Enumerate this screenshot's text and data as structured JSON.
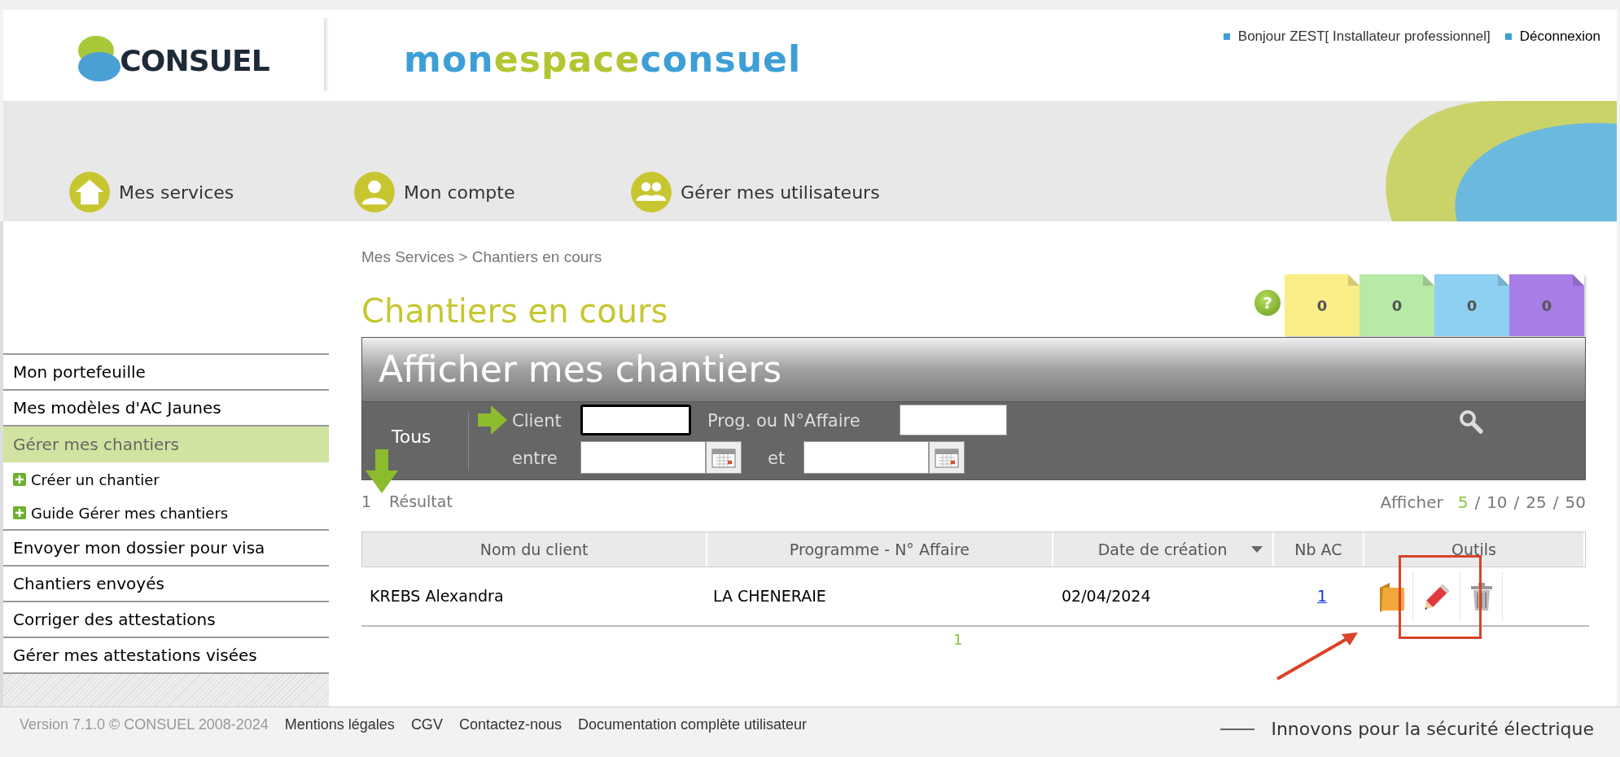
{
  "header": {
    "logo": "CONSUEL",
    "site_name": [
      {
        "text": "mon",
        "color": "#3d9fd6"
      },
      {
        "text": "espace",
        "color": "#b3c632"
      },
      {
        "text": "consuel",
        "color": "#3d9fd6"
      }
    ],
    "user_links": [
      {
        "label": "Bonjour ZEST[ Installateur professionnel]"
      },
      {
        "label": "Déconnexion"
      }
    ]
  },
  "nav": [
    {
      "label": "Mes services",
      "kind": "home"
    },
    {
      "label": "Mon compte",
      "kind": "user"
    },
    {
      "label": "Gérer mes utilisateurs",
      "kind": "users"
    }
  ],
  "sidebar": {
    "items": [
      {
        "label": "Mon portefeuille",
        "kind": "main",
        "selected": false
      },
      {
        "label": "Mes modèles d'AC Jaunes",
        "kind": "main",
        "selected": false
      },
      {
        "label": "Gérer mes chantiers",
        "kind": "main",
        "selected": true
      },
      {
        "label": "Créer un chantier",
        "kind": "sub",
        "selected": false
      },
      {
        "label": "Guide Gérer mes chantiers",
        "kind": "sub",
        "selected": false
      },
      {
        "label": "Envoyer mon dossier pour visa",
        "kind": "main",
        "selected": false
      },
      {
        "label": "Chantiers envoyés",
        "kind": "main",
        "selected": false
      },
      {
        "label": "Corriger des attestations",
        "kind": "main",
        "selected": false
      },
      {
        "label": "Gérer mes attestations visées",
        "kind": "main",
        "selected": false
      }
    ]
  },
  "breadcrumb": "Mes Services > Chantiers en cours",
  "page_title": "Chantiers en cours",
  "help": "?",
  "counters": [
    {
      "value": "0",
      "color": "#f9ee88"
    },
    {
      "value": "0",
      "color": "#b7eaa6"
    },
    {
      "value": "0",
      "color": "#8dd0f2"
    },
    {
      "value": "0",
      "color": "#a77de6"
    }
  ],
  "filter_panel": {
    "title": "Afficher mes chantiers",
    "tab": "Tous",
    "client_label": "Client",
    "prog_label": "Prog. ou N°Affaire",
    "between_label": "entre",
    "and_label": "et"
  },
  "results": {
    "count": "1",
    "label": "Résultat",
    "page_size_label": "Afficher",
    "separator": "/",
    "page_sizes": [
      {
        "label": "5",
        "selected": true
      },
      {
        "label": "10",
        "selected": false
      },
      {
        "label": "25",
        "selected": false
      },
      {
        "label": "50",
        "selected": false
      }
    ]
  },
  "table": {
    "columns": [
      "Nom du client",
      "Programme - N° Affaire",
      "Date de création",
      "Nb AC",
      "Outils"
    ],
    "rows": [
      {
        "client": "KREBS Alexandra",
        "programme": "LA CHENERAIE",
        "date": "02/04/2024",
        "nb_ac": "1"
      }
    ]
  },
  "pager": "1",
  "footer": {
    "version": "Version 7.1.0 © CONSUEL 2008-2024",
    "links": [
      "Mentions légales",
      "CGV",
      "Contactez-nous",
      "Documentation complète utilisateur"
    ],
    "tagline": "Innovons pour la sécurité électrique"
  }
}
